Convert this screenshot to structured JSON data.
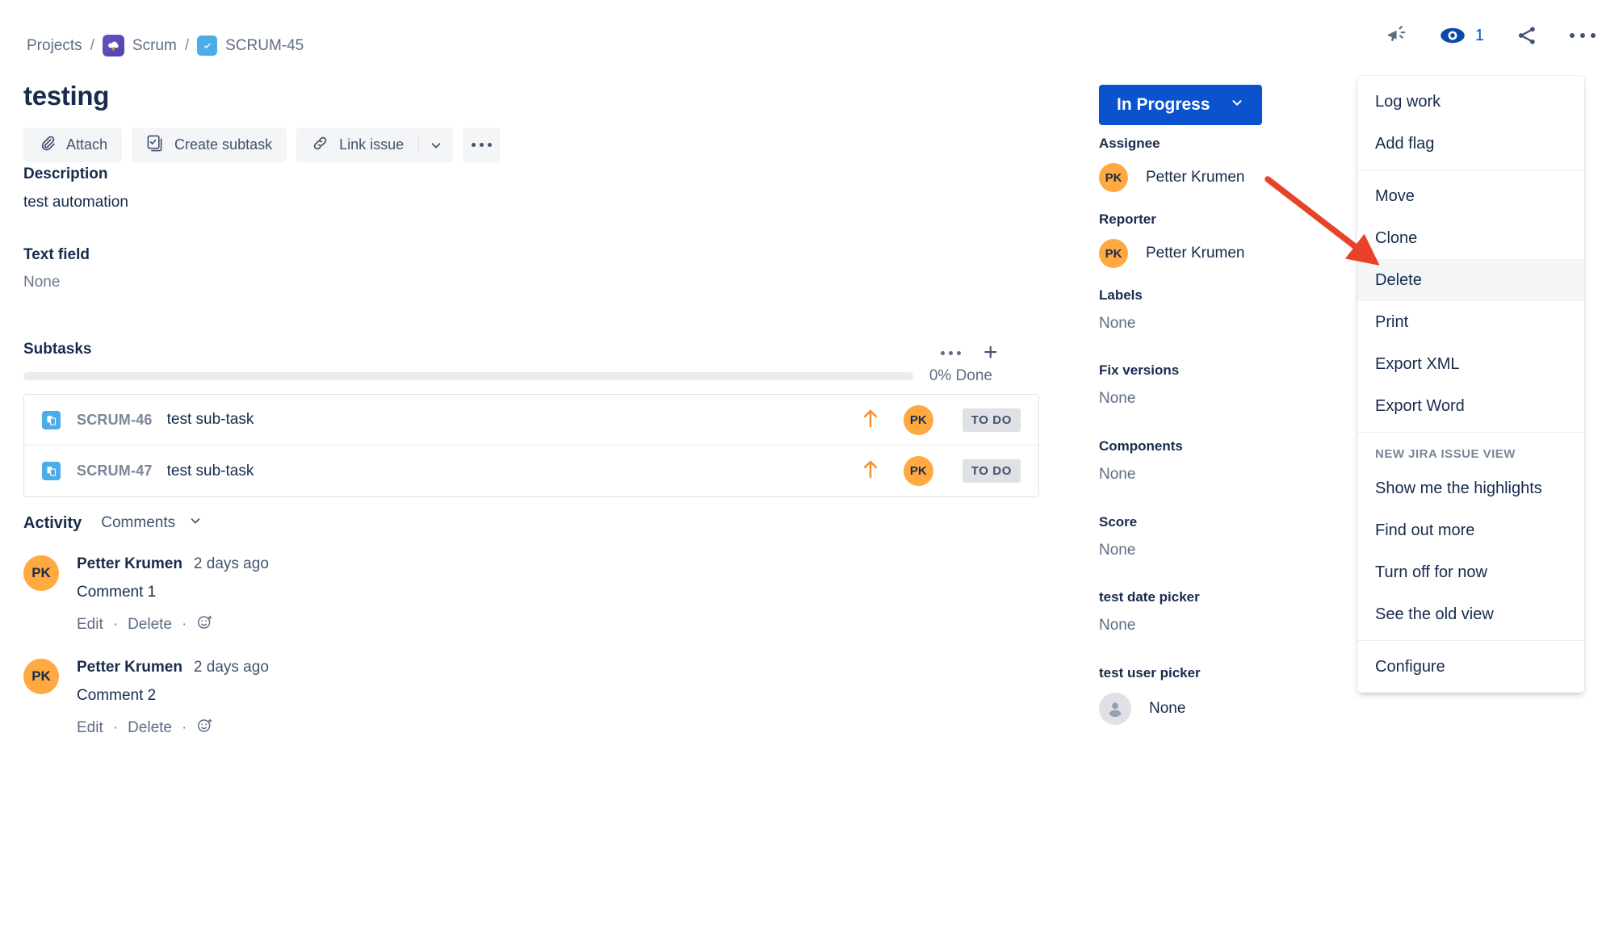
{
  "breadcrumb": {
    "projects_label": "Projects",
    "separator": "/",
    "project_name": "Scrum",
    "issue_key": "SCRUM-45"
  },
  "header": {
    "title": "testing",
    "watch_count": "1",
    "icons": [
      "feedback-megaphone-icon",
      "watch-eye-icon",
      "share-icon",
      "more-actions-icon"
    ]
  },
  "actions": {
    "attach_label": "Attach",
    "create_subtask_label": "Create subtask",
    "link_issue_label": "Link issue"
  },
  "description": {
    "label": "Description",
    "value": "test automation"
  },
  "text_field": {
    "label": "Text field",
    "value": "None"
  },
  "subtasks": {
    "title": "Subtasks",
    "progress_text": "0% Done",
    "progress_percent": 0,
    "rows": [
      {
        "key": "SCRUM-46",
        "summary": "test sub-task",
        "priority": "medium-up-arrow",
        "assignee_initials": "PK",
        "status": "TO DO"
      },
      {
        "key": "SCRUM-47",
        "summary": "test sub-task",
        "priority": "medium-up-arrow",
        "assignee_initials": "PK",
        "status": "TO DO"
      }
    ]
  },
  "activity": {
    "title": "Activity",
    "filter_label": "Comments",
    "comments": [
      {
        "initials": "PK",
        "author": "Petter Krumen",
        "time": "2 days ago",
        "body": "Comment 1",
        "edit_label": "Edit",
        "delete_label": "Delete",
        "sep": "·"
      },
      {
        "initials": "PK",
        "author": "Petter Krumen",
        "time": "2 days ago",
        "body": "Comment 2",
        "edit_label": "Edit",
        "delete_label": "Delete",
        "sep": "·"
      }
    ]
  },
  "sidebar": {
    "status_label": "In Progress",
    "status_color": "#0B53CE",
    "fields": [
      {
        "label": "Assignee",
        "value": "Petter Krumen",
        "type": "person",
        "initials": "PK"
      },
      {
        "label": "Reporter",
        "value": "Petter Krumen",
        "type": "person",
        "initials": "PK"
      },
      {
        "label": "Labels",
        "value": "None",
        "type": "none"
      },
      {
        "label": "Fix versions",
        "value": "None",
        "type": "none"
      },
      {
        "label": "Components",
        "value": "None",
        "type": "none"
      },
      {
        "label": "Score",
        "value": "None",
        "type": "none"
      },
      {
        "label": "test date picker",
        "value": "None",
        "type": "none"
      },
      {
        "label": "test user picker",
        "value": "None",
        "type": "blank-person"
      }
    ]
  },
  "more_menu": {
    "items": [
      {
        "label": "Log work",
        "kind": "item"
      },
      {
        "label": "Add flag",
        "kind": "item"
      },
      {
        "kind": "separator"
      },
      {
        "label": "Move",
        "kind": "item"
      },
      {
        "label": "Clone",
        "kind": "item"
      },
      {
        "label": "Delete",
        "kind": "item",
        "active": true
      },
      {
        "label": "Print",
        "kind": "item"
      },
      {
        "label": "Export XML",
        "kind": "item"
      },
      {
        "label": "Export Word",
        "kind": "item"
      },
      {
        "kind": "separator"
      },
      {
        "label": "NEW JIRA ISSUE VIEW",
        "kind": "heading"
      },
      {
        "label": "Show me the highlights",
        "kind": "item"
      },
      {
        "label": "Find out more",
        "kind": "item"
      },
      {
        "label": "Turn off for now",
        "kind": "item"
      },
      {
        "label": "See the old view",
        "kind": "item"
      },
      {
        "kind": "separator"
      },
      {
        "label": "Configure",
        "kind": "item"
      }
    ]
  },
  "annotation": {
    "arrow_color": "#E8432A",
    "points_to": "Delete"
  }
}
